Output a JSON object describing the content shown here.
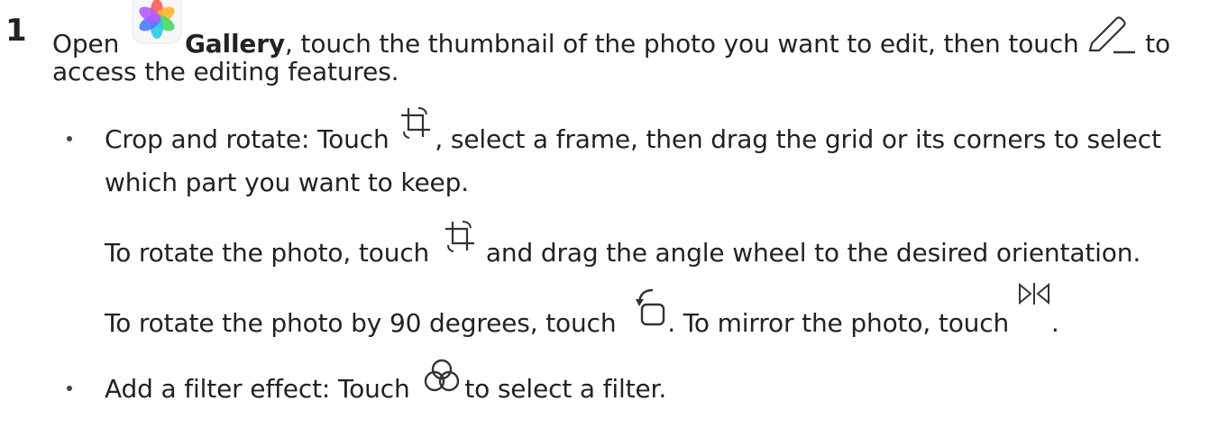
{
  "step": {
    "number": "1",
    "line1_open": "Open",
    "app_name": "Gallery",
    "line1_rest": ", touch the thumbnail of the photo you want to edit, then touch",
    "line1_end": "to",
    "line2": "access the editing features."
  },
  "bullet_crop": {
    "line1_start": "Crop and rotate: Touch",
    "line1_end": ", select a frame, then drag the grid or its corners to select",
    "line2": "which part you want to keep.",
    "rotate_start": "To rotate the photo, touch",
    "rotate_end": "and drag the angle wheel to the desired orientation.",
    "rotate90_start": "To rotate the photo by 90 degrees, touch",
    "rotate90_mid": ". To mirror the photo, touch",
    "rotate90_end": "."
  },
  "bullet_filter": {
    "start": "Add a filter effect: Touch",
    "end": "to select a filter."
  },
  "icons": {
    "gallery": "gallery-app-icon",
    "edit": "pencil-edit-icon",
    "crop": "crop-rotate-icon",
    "rotate90": "rotate-90-icon",
    "mirror": "mirror-icon",
    "filter": "filter-icon"
  }
}
